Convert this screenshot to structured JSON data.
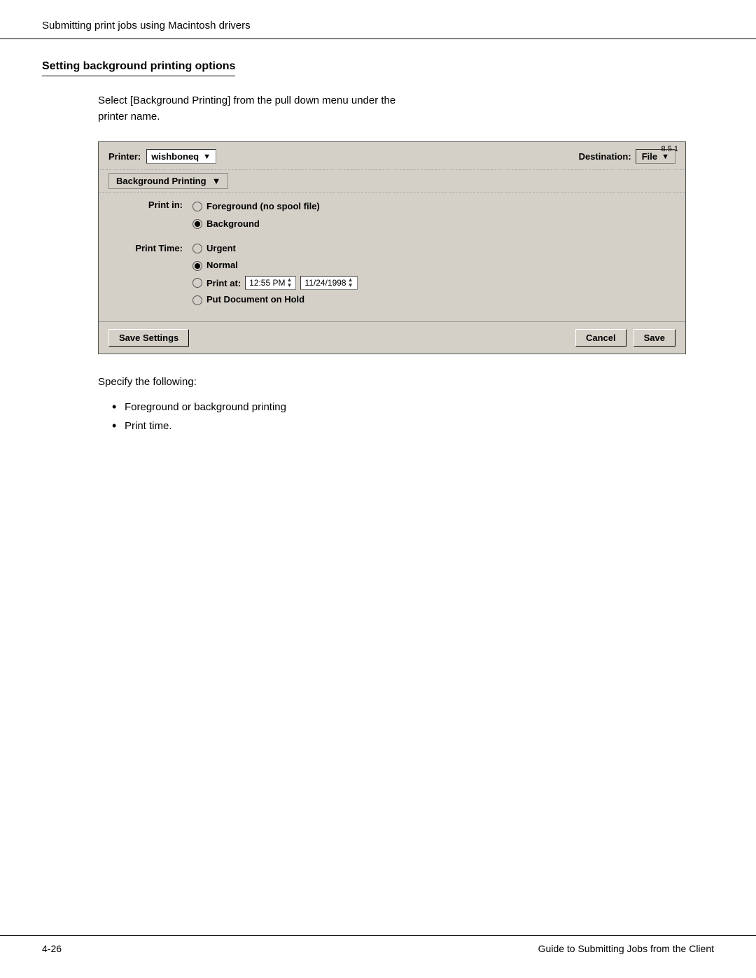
{
  "header": {
    "text": "Submitting print jobs using Macintosh drivers"
  },
  "section": {
    "heading": "Setting background printing options",
    "intro": "Select [Background Printing] from the pull down menu under the\nprinter name."
  },
  "dialog": {
    "version": "8.5.1",
    "printer_label": "Printer:",
    "printer_value": "wishboneq",
    "destination_label": "Destination:",
    "destination_value": "File",
    "dropdown_label": "Background Printing",
    "print_in_label": "Print in:",
    "option_foreground": "Foreground (no spool file)",
    "option_background": "Background",
    "print_time_label": "Print Time:",
    "option_urgent": "Urgent",
    "option_normal": "Normal",
    "option_print_at": "Print at:",
    "time_value": "12:55 PM",
    "date_value": "11/24/1998",
    "option_hold": "Put Document on Hold",
    "btn_save_settings": "Save Settings",
    "btn_cancel": "Cancel",
    "btn_save": "Save"
  },
  "after_dialog": {
    "specify_text": "Specify the following:",
    "bullets": [
      "Foreground or background printing",
      "Print time."
    ]
  },
  "footer": {
    "left": "4-26",
    "right": "Guide to Submitting Jobs from the Client"
  }
}
